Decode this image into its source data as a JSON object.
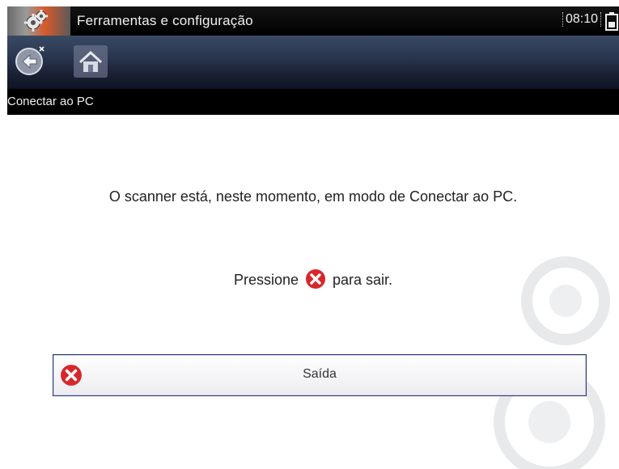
{
  "titlebar": {
    "app_icon": "gear-settings-icon",
    "title": "Ferramentas e configuração",
    "time": "08:10",
    "battery_icon": "battery-icon"
  },
  "toolbar": {
    "back_icon": "back-icon",
    "home_icon": "home-icon"
  },
  "section": {
    "title": "Conectar ao PC"
  },
  "main": {
    "message": "O scanner está, neste momento, em modo de Conectar ao PC.",
    "press_before": "Pressione",
    "press_after": "para sair.",
    "exit_icon": "close-circle-icon",
    "exit_label": "Saída"
  },
  "colors": {
    "accent_red": "#d8262b",
    "button_border": "#2b3a7a",
    "toolbar_blue": "#2a3650"
  }
}
